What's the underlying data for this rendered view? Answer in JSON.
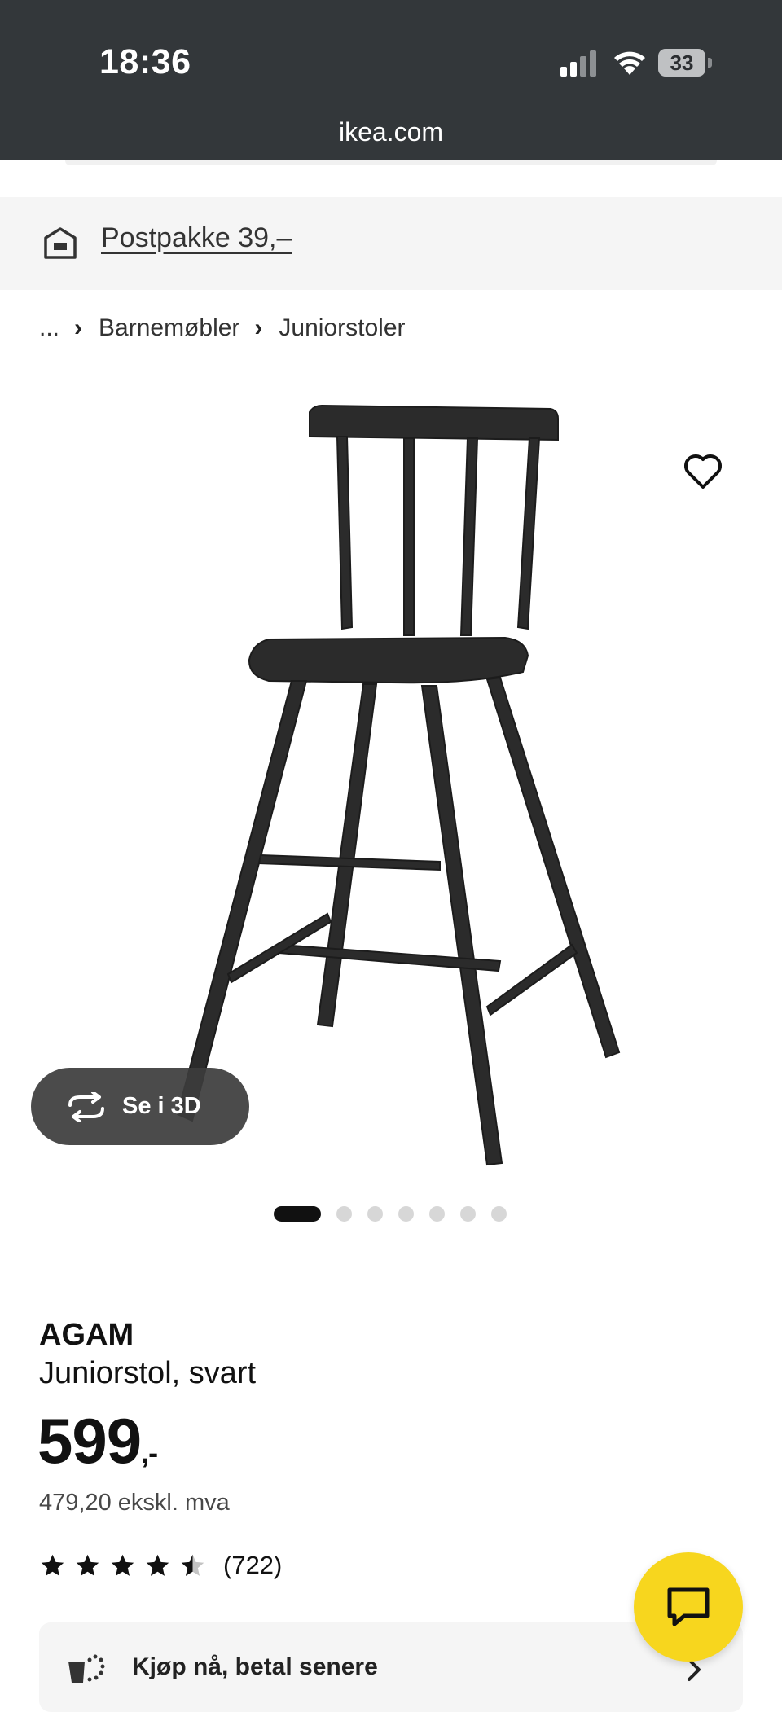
{
  "status_bar": {
    "time": "18:36",
    "battery": "33",
    "url": "ikea.com"
  },
  "shipping": {
    "icon": "delivery-box-icon",
    "label": "Postpakke 39,–"
  },
  "breadcrumb": {
    "ellipsis": "...",
    "items": [
      "Barnemøbler",
      "Juniorstoler"
    ]
  },
  "product": {
    "image": "black-junior-chair",
    "view_3d_label": "Se i 3D",
    "carousel": {
      "total": 7,
      "active": 1
    },
    "brand": "AGAM",
    "description": "Juniorstol, svart",
    "price": "599",
    "price_suffix": ",-",
    "price_ex_vat": "479,20 ekskl. mva",
    "rating": 4.5,
    "rating_max": 5,
    "review_count": "(722)"
  },
  "bnpl": {
    "label": "Kjøp nå, betal senere"
  },
  "colors": {
    "status_bar_bg": "#33373a",
    "chat_button": "#f7d61e",
    "panel_bg": "#f5f5f5"
  }
}
